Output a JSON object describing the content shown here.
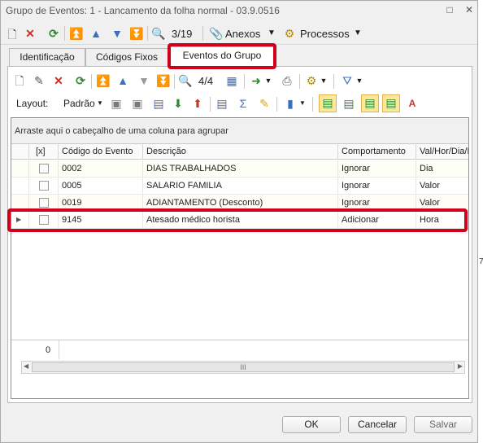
{
  "window": {
    "title": "Grupo de Eventos: 1 - Lancamento da folha normal - 03.9.0516"
  },
  "toolbar_main": {
    "record_counter": "3/19",
    "anexos_label": "Anexos",
    "processos_label": "Processos"
  },
  "tabs": [
    {
      "label": "Identificação"
    },
    {
      "label": "Códigos Fixos"
    },
    {
      "label": "Eventos do Grupo"
    }
  ],
  "toolbar_grid": {
    "record_counter": "4/4",
    "layout_label": "Layout:",
    "layout_value": "Padrão"
  },
  "grid": {
    "group_hint": "Arraste aqui o cabeçalho de uma coluna para agrupar",
    "columns": [
      "[x]",
      "Código do Evento",
      "Descrição",
      "Comportamento",
      "Val/Hor/Dia/M"
    ],
    "rows": [
      {
        "codigo": "0002",
        "descricao": "DIAS TRABALHADOS",
        "comportamento": "Ignorar",
        "tipo": "Dia"
      },
      {
        "codigo": "0005",
        "descricao": "SALARIO FAMILIA",
        "comportamento": "Ignorar",
        "tipo": "Valor"
      },
      {
        "codigo": "0019",
        "descricao": "ADIANTAMENTO (Desconto)",
        "comportamento": "Ignorar",
        "tipo": "Valor"
      },
      {
        "codigo": "9145",
        "descricao": "Atesado médico horista",
        "comportamento": "Adicionar",
        "tipo": "Hora"
      }
    ],
    "footer_count": "0",
    "scroll_thumb_label": "III"
  },
  "buttons": {
    "ok": "OK",
    "cancel": "Cancelar",
    "save": "Salvar"
  },
  "side_fragment": "7",
  "colors": {
    "highlight": "#d0021b",
    "active_row_indicator": "#555555"
  }
}
